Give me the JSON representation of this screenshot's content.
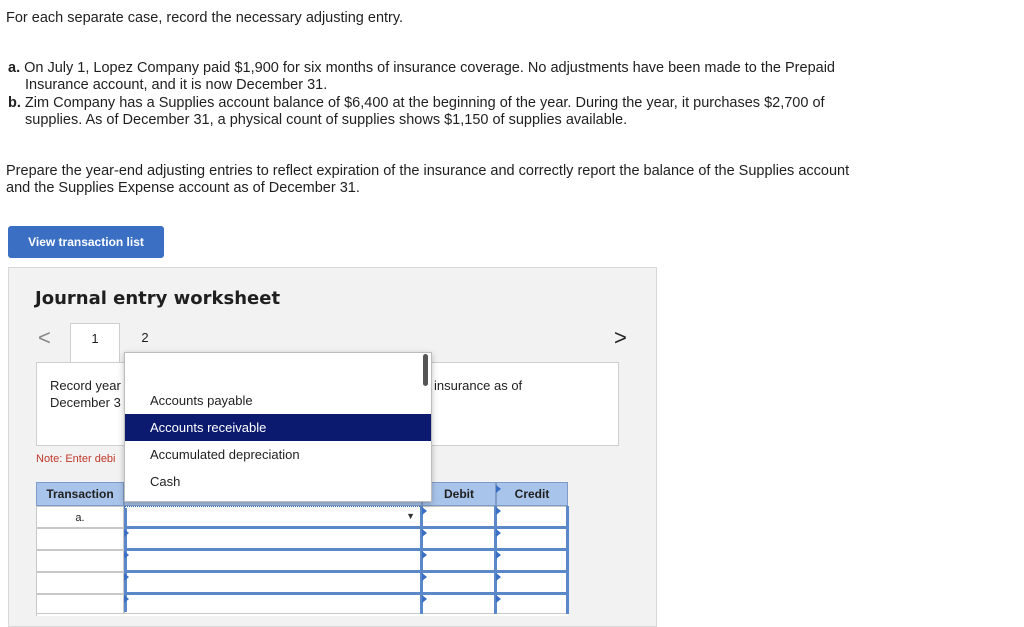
{
  "instructions": {
    "intro": "For each separate case, record the necessary adjusting entry.",
    "case_a_label": "a.",
    "case_a_line1": "On July 1, Lopez Company paid $1,900 for six months of insurance coverage. No adjustments have been made to the Prepaid",
    "case_a_line2": "Insurance account, and it is now December 31.",
    "case_b_label": "b.",
    "case_b_line1": "Zim Company has a Supplies account balance of $6,400 at the beginning of the year. During the year, it purchases $2,700 of",
    "case_b_line2": "supplies. As of December 31, a physical count of supplies shows $1,150 of supplies available.",
    "prepare_line1": "Prepare the year-end adjusting entries to reflect expiration of the insurance and correctly report the balance of the Supplies account",
    "prepare_line2": "and the Supplies Expense account as of December 31."
  },
  "view_button_label": "View transaction list",
  "worksheet": {
    "title": "Journal entry worksheet",
    "tabs": [
      "1",
      "2"
    ],
    "prev_arrow": "<",
    "next_arrow": ">",
    "record_line1": "Record year",
    "record_line2": "December 3",
    "record_tail": "insurance as of",
    "note": "Note: Enter debi",
    "columns": {
      "transaction": "Transaction",
      "debit": "Debit",
      "credit": "Credit"
    },
    "rows": [
      {
        "transaction": "a."
      },
      {
        "transaction": ""
      },
      {
        "transaction": ""
      },
      {
        "transaction": ""
      },
      {
        "transaction": ""
      }
    ]
  },
  "dropdown": {
    "options": [
      "Accounts payable",
      "Accounts receivable",
      "Accumulated depreciation",
      "Cash"
    ],
    "selected_index": 1
  },
  "colors": {
    "button_blue": "#3a6fc4",
    "header_blue": "#a9c4ea",
    "selected_option": "#0b1a6e",
    "note_red": "#c0392b"
  }
}
